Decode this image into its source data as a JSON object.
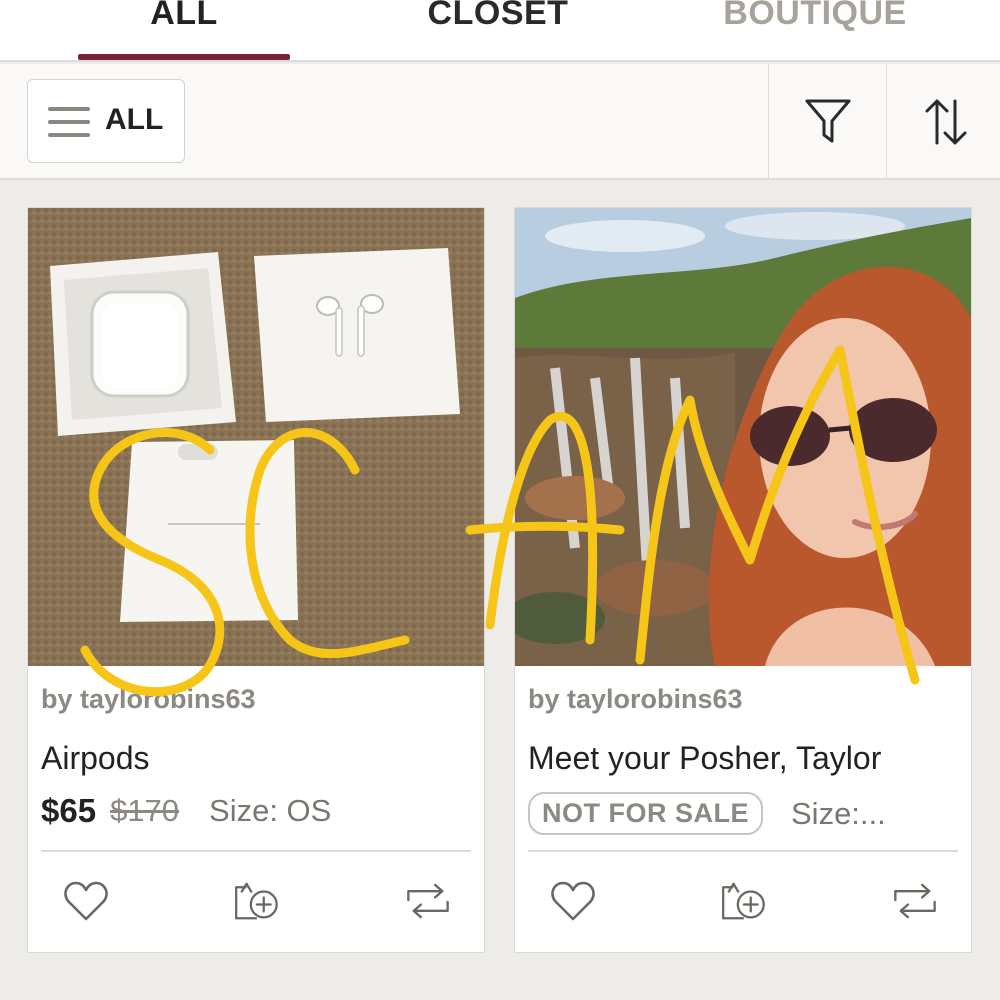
{
  "tabs": [
    {
      "label": "ALL",
      "active": true
    },
    {
      "label": "CLOSET",
      "active": false
    },
    {
      "label": "BOUTIQUE",
      "active": false
    }
  ],
  "filter_bar": {
    "all_label": "ALL",
    "icons": [
      "filter-icon",
      "sort-icon"
    ]
  },
  "listings": [
    {
      "seller": "by taylorobins63",
      "title": "Airpods",
      "price": "$65",
      "original_price": "$170",
      "size": "Size: OS"
    },
    {
      "seller": "by taylorobins63",
      "title": "Meet your Posher, Taylor",
      "badge": "NOT FOR SALE",
      "size": "Size:..."
    }
  ],
  "card_actions": [
    "heart-icon",
    "share-icon",
    "repost-icon"
  ],
  "annotation": {
    "text": "SCAM",
    "color": "#f5c518"
  },
  "colors": {
    "accent": "#7c2238",
    "muted": "#8c8882"
  }
}
